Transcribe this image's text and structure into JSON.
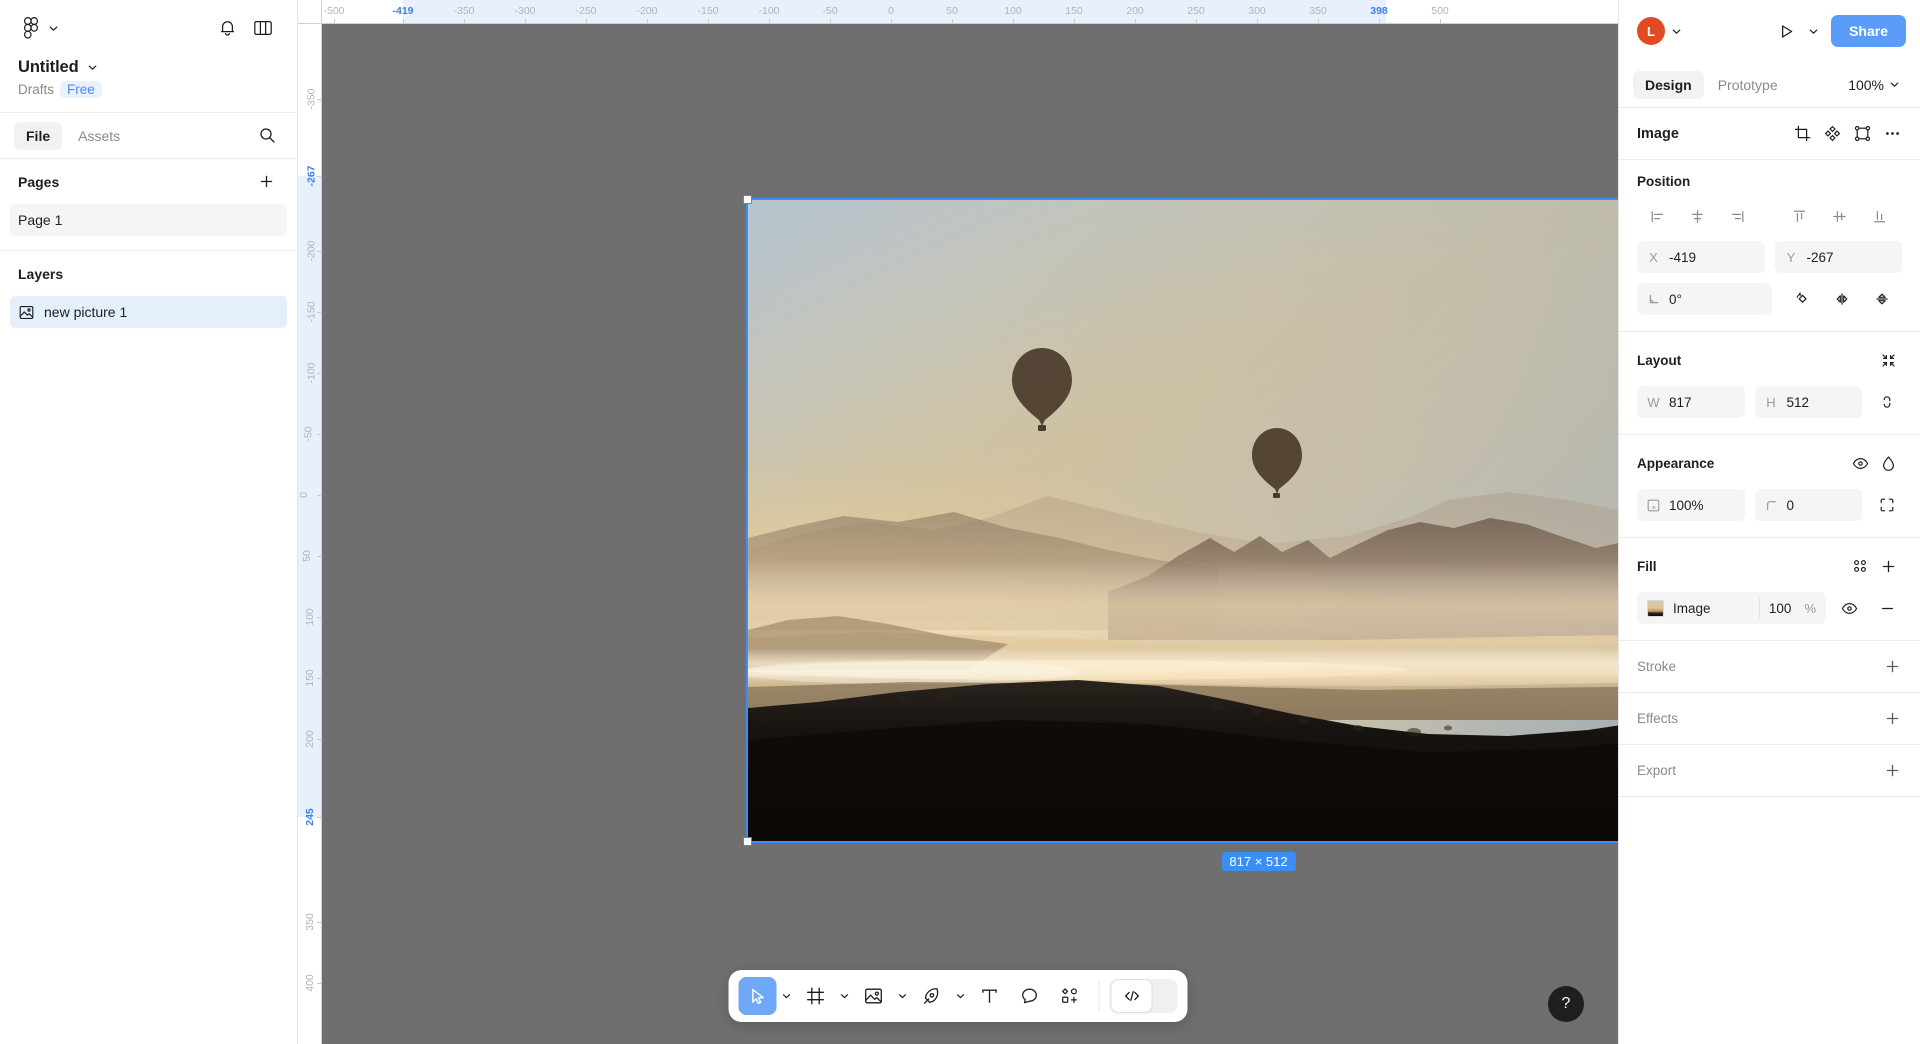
{
  "left_panel": {
    "logo_icon": "figma-logo-icon",
    "logo_chevron_icon": "chevron-down-icon",
    "notifications_icon": "bell-icon",
    "panel_toggle_icon": "panel-layout-icon",
    "file_title": "Untitled",
    "file_title_chevron_icon": "chevron-down-icon",
    "drafts_label": "Drafts",
    "plan_badge": "Free",
    "tabs": [
      {
        "label": "File",
        "active": true
      },
      {
        "label": "Assets",
        "active": false
      }
    ],
    "search_icon": "search-icon",
    "pages_header": "Pages",
    "pages_add_icon": "plus-icon",
    "pages": [
      {
        "label": "Page 1",
        "selected": true
      }
    ],
    "layers_header": "Layers",
    "layers": [
      {
        "label": "new picture 1",
        "icon": "image-icon",
        "selected": true
      }
    ]
  },
  "canvas": {
    "background_color": "#6f6f6f",
    "ruler_h_ticks": [
      "-500",
      "-419",
      "-350",
      "-300",
      "-250",
      "-200",
      "-150",
      "-100",
      "-50",
      "0",
      "50",
      "100",
      "150",
      "200",
      "250",
      "300",
      "350",
      "398",
      "500"
    ],
    "ruler_h_active": [
      "-419",
      "398"
    ],
    "ruler_v_ticks": [
      "-350",
      "-267",
      "-200",
      "-150",
      "-100",
      "-50",
      "0",
      "50",
      "100",
      "150",
      "200",
      "245",
      "350",
      "400"
    ],
    "ruler_v_active": [
      "-267",
      "245"
    ],
    "selection_dimension_badge": "817 × 512",
    "selection_color": "#3b8ef3",
    "node_name": "new picture 1"
  },
  "toolbar": {
    "tools": [
      {
        "name": "move-tool",
        "icon": "cursor-icon",
        "active": true,
        "has_chevron": true
      },
      {
        "name": "frame-tool",
        "icon": "frame-icon",
        "active": false,
        "has_chevron": true
      },
      {
        "name": "image-tool",
        "icon": "image-icon",
        "active": false,
        "has_chevron": true
      },
      {
        "name": "pen-tool",
        "icon": "pen-icon",
        "active": false,
        "has_chevron": true
      },
      {
        "name": "text-tool",
        "icon": "text-icon",
        "active": false,
        "has_chevron": false
      },
      {
        "name": "comment-tool",
        "icon": "comment-icon",
        "active": false,
        "has_chevron": false
      },
      {
        "name": "actions-tool",
        "icon": "shapes-plus-icon",
        "active": false,
        "has_chevron": false
      }
    ],
    "dev_mode_icon": "code-brackets-icon",
    "dev_mode_active": false
  },
  "help": {
    "label": "?",
    "icon": "question-mark-icon"
  },
  "right_panel": {
    "avatar_initial": "L",
    "avatar_color": "#e24a23",
    "avatar_chevron_icon": "chevron-down-icon",
    "present_icon": "play-icon",
    "present_chevron_icon": "chevron-down-icon",
    "share_label": "Share",
    "share_color": "#5b9cf8",
    "tabs": [
      {
        "label": "Design",
        "active": true
      },
      {
        "label": "Prototype",
        "active": false
      }
    ],
    "zoom_level": "100%",
    "zoom_chevron_icon": "chevron-down-icon",
    "node_title": "Image",
    "node_actions": [
      {
        "name": "crop-icon"
      },
      {
        "name": "component-icon"
      },
      {
        "name": "mask-icon"
      },
      {
        "name": "more-options-icon"
      }
    ],
    "position": {
      "title": "Position",
      "align_horizontal": [
        {
          "name": "align-left-icon"
        },
        {
          "name": "align-horizontal-center-icon"
        },
        {
          "name": "align-right-icon"
        }
      ],
      "align_vertical": [
        {
          "name": "align-top-icon"
        },
        {
          "name": "align-vertical-center-icon"
        },
        {
          "name": "align-bottom-icon"
        }
      ],
      "x_label": "X",
      "x_value": "-419",
      "y_label": "Y",
      "y_value": "-267",
      "rotation_label": "rotation-icon",
      "rotation_value": "0°",
      "transform_buttons": [
        {
          "name": "rotate-icon"
        },
        {
          "name": "flip-horizontal-icon"
        },
        {
          "name": "flip-vertical-icon"
        }
      ]
    },
    "layout": {
      "title": "Layout",
      "resize_icon": "collapse-to-fit-icon",
      "w_label": "W",
      "w_value": "817",
      "h_label": "H",
      "h_value": "512",
      "constrain_icon": "constrain-proportions-icon"
    },
    "appearance": {
      "title": "Appearance",
      "visibility_icon": "eye-icon",
      "blend_icon": "blend-mode-icon",
      "opacity_icon": "opacity-icon",
      "opacity_value": "100%",
      "corner_icon": "corner-radius-icon",
      "corner_value": "0",
      "individual_corners_icon": "individual-corners-icon"
    },
    "fill": {
      "title": "Fill",
      "styles_icon": "styles-icon",
      "add_icon": "plus-icon",
      "items": [
        {
          "swatch": "image-thumbnail",
          "name": "Image",
          "opacity": "100",
          "percent_symbol": "%",
          "visibility_icon": "eye-icon",
          "remove_icon": "minus-icon"
        }
      ]
    },
    "stroke": {
      "title": "Stroke",
      "add_icon": "plus-icon"
    },
    "effects": {
      "title": "Effects",
      "add_icon": "plus-icon"
    },
    "export": {
      "title": "Export",
      "add_icon": "plus-icon"
    }
  }
}
